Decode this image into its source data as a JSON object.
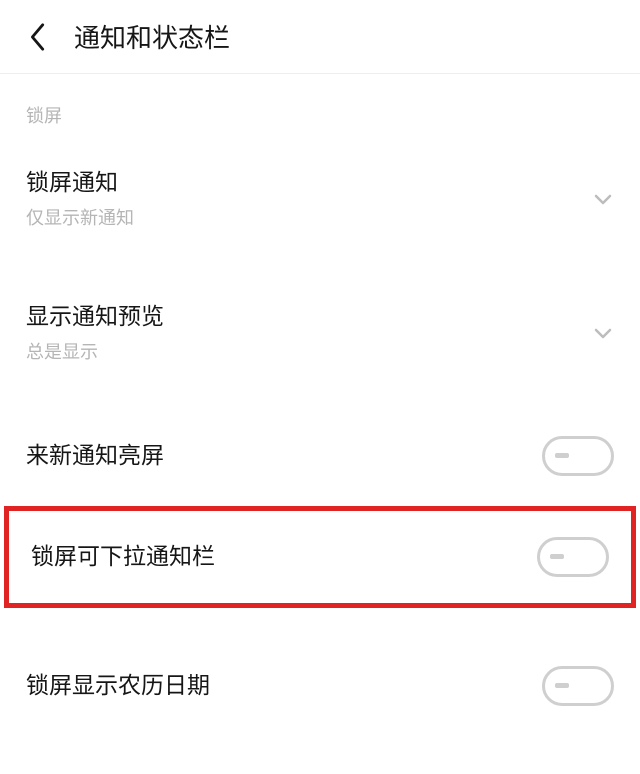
{
  "header": {
    "title": "通知和状态栏",
    "back_icon": "chevron-left"
  },
  "section": {
    "title": "锁屏"
  },
  "rows": {
    "lock_notify": {
      "title": "锁屏通知",
      "sub": "仅显示新通知"
    },
    "preview": {
      "title": "显示通知预览",
      "sub": "总是显示"
    },
    "wake": {
      "title": "来新通知亮屏"
    },
    "pulldown": {
      "title": "锁屏可下拉通知栏"
    },
    "lunar": {
      "title": "锁屏显示农历日期"
    }
  }
}
